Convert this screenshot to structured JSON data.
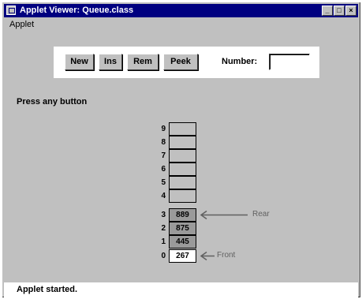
{
  "window": {
    "title": "Applet Viewer: Queue.class",
    "minimize_glyph": "_",
    "maximize_glyph": "□",
    "close_glyph": "×"
  },
  "menu": {
    "items": [
      "Applet"
    ]
  },
  "toolbar": {
    "new_label": "New",
    "ins_label": "Ins",
    "rem_label": "Rem",
    "peek_label": "Peek",
    "number_label": "Number:",
    "number_value": ""
  },
  "message": "Press any button",
  "queue": {
    "cells": [
      {
        "index": "9",
        "value": ""
      },
      {
        "index": "8",
        "value": ""
      },
      {
        "index": "7",
        "value": ""
      },
      {
        "index": "6",
        "value": ""
      },
      {
        "index": "5",
        "value": ""
      },
      {
        "index": "4",
        "value": ""
      },
      {
        "index": "3",
        "value": "889"
      },
      {
        "index": "2",
        "value": "875"
      },
      {
        "index": "1",
        "value": "445"
      },
      {
        "index": "0",
        "value": "267"
      }
    ],
    "rear_label": "Rear",
    "front_label": "Front"
  },
  "status": "Applet started."
}
